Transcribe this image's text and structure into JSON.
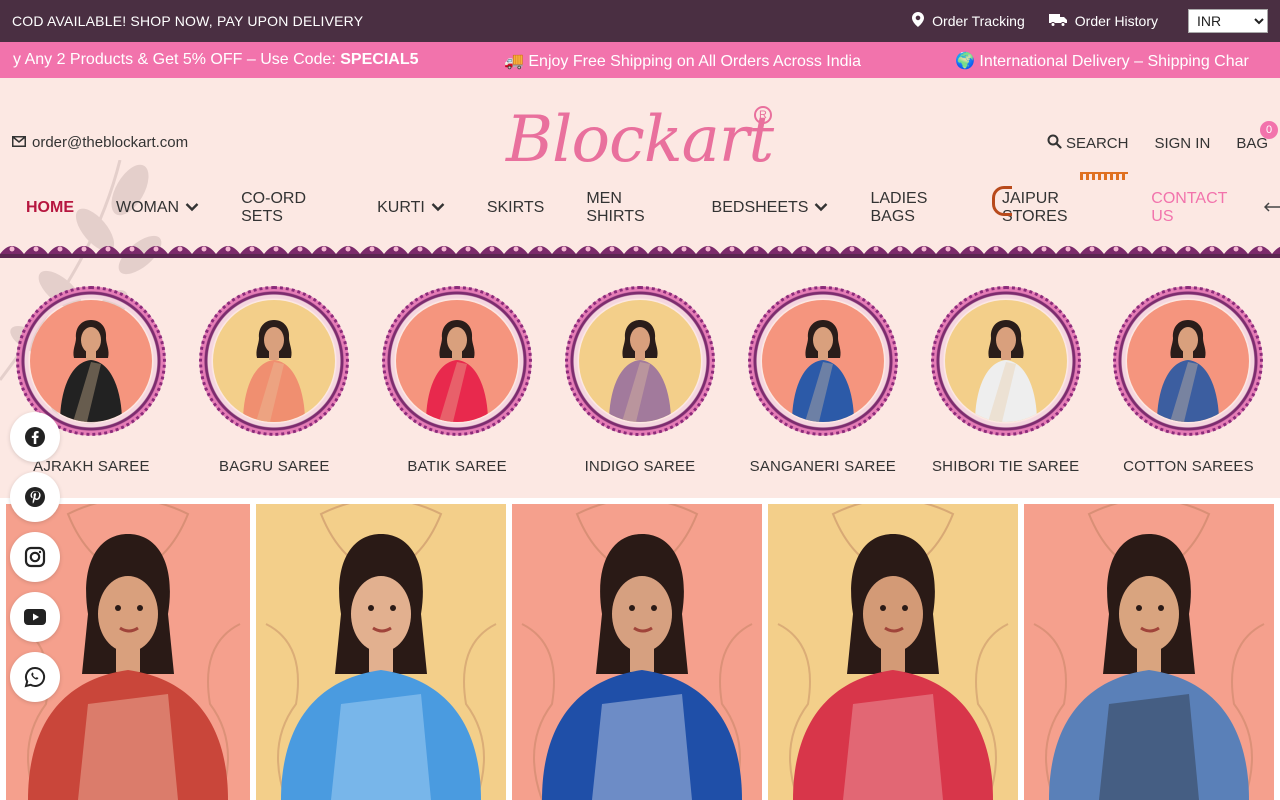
{
  "topbar": {
    "announcement": "COD AVAILABLE! SHOP NOW, PAY UPON DELIVERY",
    "order_tracking": "Order Tracking",
    "order_history": "Order History",
    "currency": "INR"
  },
  "marquee": {
    "item1_text": "y Any 2 Products & Get 5% OFF – Use Code: ",
    "item1_code": "SPECIAL5",
    "item2": "🚚 Enjoy Free Shipping on All Orders Across India",
    "item3": "🌍 International Delivery – Shipping Char"
  },
  "header": {
    "email": "order@theblockart.com",
    "logo_text": "Blockart",
    "logo_reg": "R",
    "search": "SEARCH",
    "sign_in": "SIGN IN",
    "bag": "BAG",
    "bag_count": "0"
  },
  "nav": {
    "home": "HOME",
    "woman": "WOMAN",
    "coord": "CO-ORD SETS",
    "kurti": "KURTI",
    "skirts": "SKIRTS",
    "men_shirts": "MEN SHIRTS",
    "bedsheets": "BEDSHEETS",
    "ladies_bags": "LADIES BAGS",
    "jaipur": "JAIPUR STORES",
    "contact": "CONTACT US"
  },
  "categories": [
    {
      "label": "AJRAKH SAREE",
      "bg": "#f5957e",
      "saree": "#222222"
    },
    {
      "label": "BAGRU SAREE",
      "bg": "#f3cf8a",
      "saree": "#f08f70"
    },
    {
      "label": "BATIK SAREE",
      "bg": "#f5957e",
      "saree": "#e8294d"
    },
    {
      "label": "INDIGO SAREE",
      "bg": "#f3cf8a",
      "saree": "#a27a9c"
    },
    {
      "label": "SANGANERI SAREE",
      "bg": "#f5957e",
      "saree": "#2c5aa8"
    },
    {
      "label": "SHIBORI TIE SAREE",
      "bg": "#f3cf8a",
      "saree": "#eeeeee"
    },
    {
      "label": "COTTON SAREES",
      "bg": "#f5957e",
      "saree": "#3c5ea0"
    }
  ],
  "colors": {
    "topbar": "#4a2f42",
    "marquee": "#f273ac",
    "accent_red": "#b6163f",
    "pink": "#e9709d",
    "panel_salmon": "#f5a08d",
    "panel_gold": "#f3cf8a"
  },
  "social": [
    "facebook-icon",
    "pinterest-icon",
    "instagram-icon",
    "youtube-icon",
    "whatsapp-icon"
  ]
}
